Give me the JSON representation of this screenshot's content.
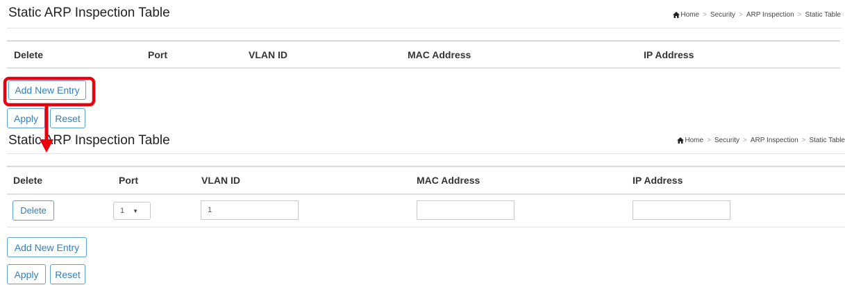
{
  "panel1": {
    "title": "Static ARP Inspection Table",
    "breadcrumb": {
      "home": "Home",
      "security": "Security",
      "arp": "ARP Inspection",
      "current": "Static Table"
    },
    "columns": [
      "Delete",
      "Port",
      "VLAN ID",
      "MAC Address",
      "IP Address"
    ],
    "add_label": "Add New Entry",
    "apply_label": "Apply",
    "reset_label": "Reset"
  },
  "panel2": {
    "title": "Static ARP Inspection Table",
    "breadcrumb": {
      "home": "Home",
      "security": "Security",
      "arp": "ARP Inspection",
      "current": "Static Table"
    },
    "columns": [
      "Delete",
      "Port",
      "VLAN ID",
      "MAC Address",
      "IP Address"
    ],
    "row": {
      "delete_label": "Delete",
      "port_value": "1",
      "vlan_value": "1",
      "mac_value": "",
      "ip_value": ""
    },
    "add_label": "Add New Entry",
    "apply_label": "Apply",
    "reset_label": "Reset"
  },
  "annotation": {
    "highlight_color": "#e8000d"
  }
}
